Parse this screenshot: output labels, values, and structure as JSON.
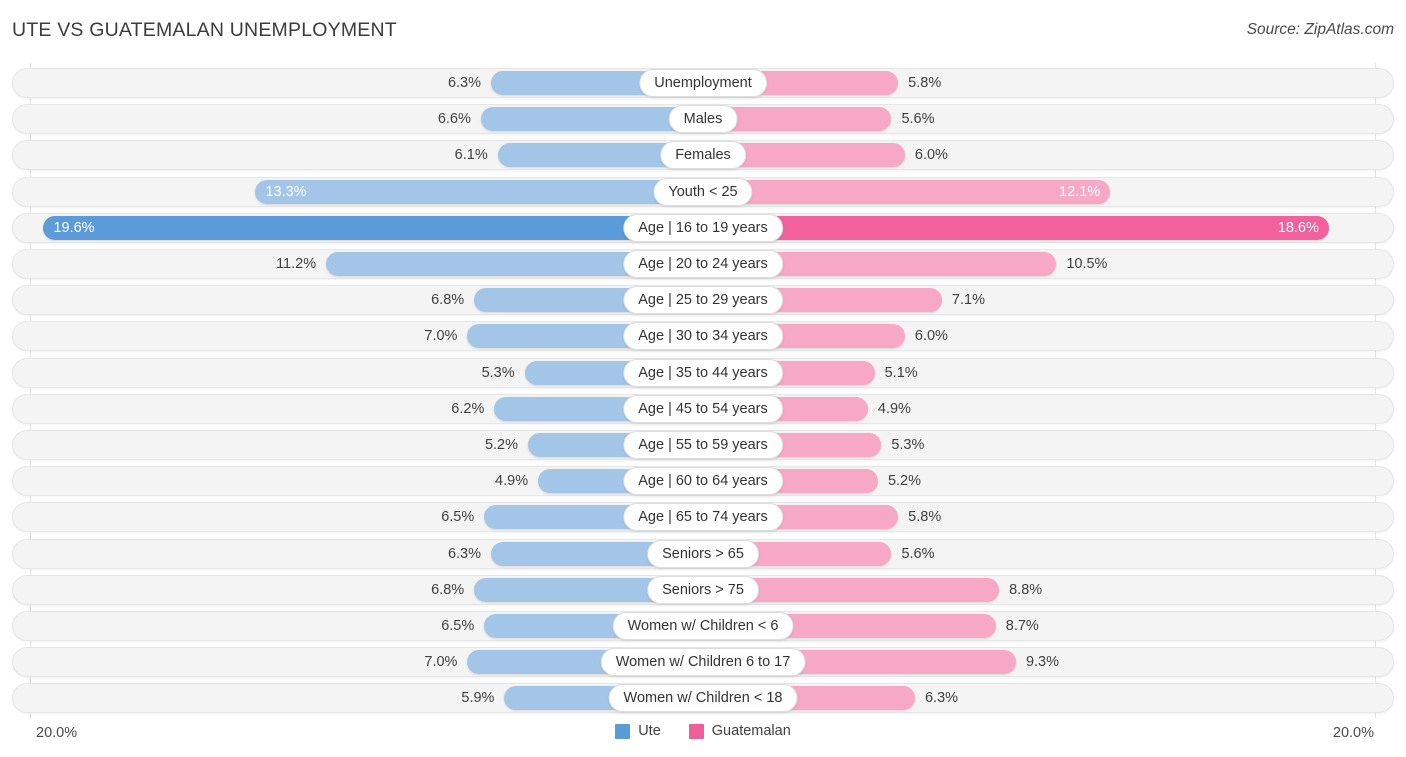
{
  "header": {
    "title": "UTE VS GUATEMALAN UNEMPLOYMENT",
    "source": "Source: ZipAtlas.com"
  },
  "axis": {
    "left_end": "20.0%",
    "right_end": "20.0%"
  },
  "legend": {
    "items": [
      {
        "label": "Ute",
        "color": "#5b9bd5"
      },
      {
        "label": "Guatemalan",
        "color": "#ee5e99"
      }
    ]
  },
  "colors": {
    "left_bar": "#a3c6e8",
    "left_bar_highlight": "#5b9bd9",
    "right_bar": "#f7a8c4",
    "right_bar_highlight": "#f2619b",
    "track": "#f4f4f4",
    "gridline": "#e3e3e3"
  },
  "chart_data": {
    "type": "bar",
    "subtype": "diverging-bidirectional",
    "title": "UTE VS GUATEMALAN UNEMPLOYMENT",
    "source": "Source: ZipAtlas.com",
    "xlabel": "",
    "ylabel": "",
    "axis_max_percent": 20.0,
    "axis_left_label": "20.0%",
    "axis_right_label": "20.0%",
    "grid": true,
    "legend_position": "bottom-center",
    "categories": [
      "Unemployment",
      "Males",
      "Females",
      "Youth < 25",
      "Age | 16 to 19 years",
      "Age | 20 to 24 years",
      "Age | 25 to 29 years",
      "Age | 30 to 34 years",
      "Age | 35 to 44 years",
      "Age | 45 to 54 years",
      "Age | 55 to 59 years",
      "Age | 60 to 64 years",
      "Age | 65 to 74 years",
      "Seniors > 65",
      "Seniors > 75",
      "Women w/ Children < 6",
      "Women w/ Children 6 to 17",
      "Women w/ Children < 18"
    ],
    "series": [
      {
        "name": "Ute",
        "side": "left",
        "color": "#a3c6e8",
        "values": [
          6.3,
          6.6,
          6.1,
          13.3,
          19.6,
          11.2,
          6.8,
          7.0,
          5.3,
          6.2,
          5.2,
          4.9,
          6.5,
          6.3,
          6.8,
          6.5,
          7.0,
          5.9
        ],
        "labels": [
          "6.3%",
          "6.6%",
          "6.1%",
          "13.3%",
          "19.6%",
          "11.2%",
          "6.8%",
          "7.0%",
          "5.3%",
          "6.2%",
          "5.2%",
          "4.9%",
          "6.5%",
          "6.3%",
          "6.8%",
          "6.5%",
          "7.0%",
          "5.9%"
        ]
      },
      {
        "name": "Guatemalan",
        "side": "right",
        "color": "#f7a8c4",
        "values": [
          5.8,
          5.6,
          6.0,
          12.1,
          18.6,
          10.5,
          7.1,
          6.0,
          5.1,
          4.9,
          5.3,
          5.2,
          5.8,
          5.6,
          8.8,
          8.7,
          9.3,
          6.3
        ],
        "labels": [
          "5.8%",
          "5.6%",
          "6.0%",
          "12.1%",
          "18.6%",
          "10.5%",
          "7.1%",
          "6.0%",
          "5.1%",
          "4.9%",
          "5.3%",
          "5.2%",
          "5.8%",
          "5.6%",
          "8.8%",
          "8.7%",
          "9.3%",
          "6.3%"
        ]
      }
    ]
  },
  "rows": [
    {
      "label": "Unemployment",
      "left": "6.3%",
      "right": "5.8%",
      "left_val": 6.3,
      "right_val": 5.8,
      "highlight": false,
      "left_inside": false,
      "right_inside": false
    },
    {
      "label": "Males",
      "left": "6.6%",
      "right": "5.6%",
      "left_val": 6.6,
      "right_val": 5.6,
      "highlight": false,
      "left_inside": false,
      "right_inside": false
    },
    {
      "label": "Females",
      "left": "6.1%",
      "right": "6.0%",
      "left_val": 6.1,
      "right_val": 6.0,
      "highlight": false,
      "left_inside": false,
      "right_inside": false
    },
    {
      "label": "Youth < 25",
      "left": "13.3%",
      "right": "12.1%",
      "left_val": 13.3,
      "right_val": 12.1,
      "highlight": false,
      "left_inside": true,
      "right_inside": true
    },
    {
      "label": "Age | 16 to 19 years",
      "left": "19.6%",
      "right": "18.6%",
      "left_val": 19.6,
      "right_val": 18.6,
      "highlight": true,
      "left_inside": true,
      "right_inside": true
    },
    {
      "label": "Age | 20 to 24 years",
      "left": "11.2%",
      "right": "10.5%",
      "left_val": 11.2,
      "right_val": 10.5,
      "highlight": false,
      "left_inside": false,
      "right_inside": false
    },
    {
      "label": "Age | 25 to 29 years",
      "left": "6.8%",
      "right": "7.1%",
      "left_val": 6.8,
      "right_val": 7.1,
      "highlight": false,
      "left_inside": false,
      "right_inside": false
    },
    {
      "label": "Age | 30 to 34 years",
      "left": "7.0%",
      "right": "6.0%",
      "left_val": 7.0,
      "right_val": 6.0,
      "highlight": false,
      "left_inside": false,
      "right_inside": false
    },
    {
      "label": "Age | 35 to 44 years",
      "left": "5.3%",
      "right": "5.1%",
      "left_val": 5.3,
      "right_val": 5.1,
      "highlight": false,
      "left_inside": false,
      "right_inside": false
    },
    {
      "label": "Age | 45 to 54 years",
      "left": "6.2%",
      "right": "4.9%",
      "left_val": 6.2,
      "right_val": 4.9,
      "highlight": false,
      "left_inside": false,
      "right_inside": false
    },
    {
      "label": "Age | 55 to 59 years",
      "left": "5.2%",
      "right": "5.3%",
      "left_val": 5.2,
      "right_val": 5.3,
      "highlight": false,
      "left_inside": false,
      "right_inside": false
    },
    {
      "label": "Age | 60 to 64 years",
      "left": "4.9%",
      "right": "5.2%",
      "left_val": 4.9,
      "right_val": 5.2,
      "highlight": false,
      "left_inside": false,
      "right_inside": false
    },
    {
      "label": "Age | 65 to 74 years",
      "left": "6.5%",
      "right": "5.8%",
      "left_val": 6.5,
      "right_val": 5.8,
      "highlight": false,
      "left_inside": false,
      "right_inside": false
    },
    {
      "label": "Seniors > 65",
      "left": "6.3%",
      "right": "5.6%",
      "left_val": 6.3,
      "right_val": 5.6,
      "highlight": false,
      "left_inside": false,
      "right_inside": false
    },
    {
      "label": "Seniors > 75",
      "left": "6.8%",
      "right": "8.8%",
      "left_val": 6.8,
      "right_val": 8.8,
      "highlight": false,
      "left_inside": false,
      "right_inside": false
    },
    {
      "label": "Women w/ Children < 6",
      "left": "6.5%",
      "right": "8.7%",
      "left_val": 6.5,
      "right_val": 8.7,
      "highlight": false,
      "left_inside": false,
      "right_inside": false
    },
    {
      "label": "Women w/ Children 6 to 17",
      "left": "7.0%",
      "right": "9.3%",
      "left_val": 7.0,
      "right_val": 9.3,
      "highlight": false,
      "left_inside": false,
      "right_inside": false
    },
    {
      "label": "Women w/ Children < 18",
      "left": "5.9%",
      "right": "6.3%",
      "left_val": 5.9,
      "right_val": 6.3,
      "highlight": false,
      "left_inside": false,
      "right_inside": false
    }
  ]
}
